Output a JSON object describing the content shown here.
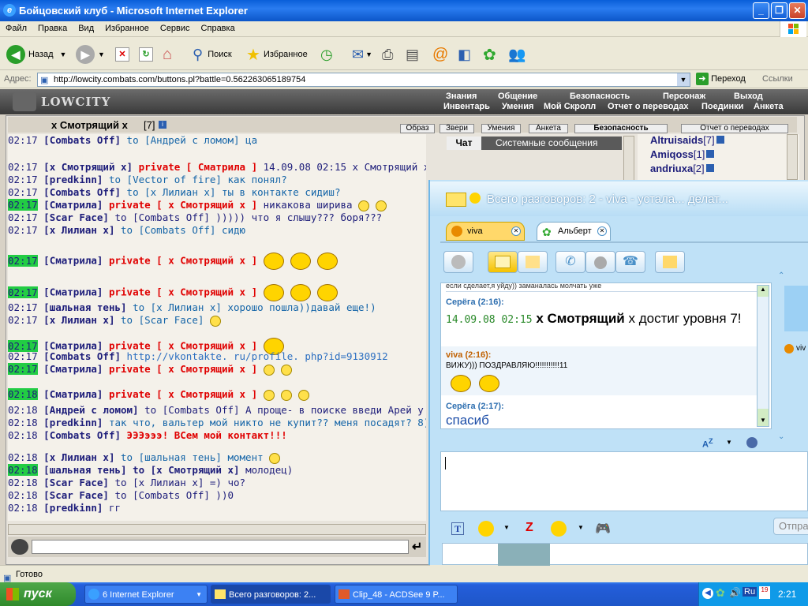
{
  "window": {
    "title": "Бойцовский клуб - Microsoft Internet Explorer"
  },
  "menu": [
    "Файл",
    "Правка",
    "Вид",
    "Избранное",
    "Сервис",
    "Справка"
  ],
  "toolbar": {
    "back": "Назад",
    "search": "Поиск",
    "favorites": "Избранное"
  },
  "address": {
    "label": "Адрес:",
    "url": "http://lowcity.combats.com/buttons.pl?battle=0.562263065189754",
    "go": "Переход",
    "links": "Ссылки"
  },
  "game": {
    "logo": "LOWCITY",
    "nav_top": [
      "Знания",
      "Общение",
      "Безопасность",
      "Персонаж",
      "Выход"
    ],
    "nav_bottom": [
      "Инвентарь",
      "Умения",
      "Мой Скролл",
      "Отчет о переводах",
      "Поединки",
      "Анкета"
    ],
    "current_user": "x Смотрящий x",
    "current_user_level": "[7]",
    "tabs_top": [
      "Образ",
      "Звери",
      "Умения",
      "Анкета",
      "Безопасность",
      "Отчет о переводах"
    ],
    "chat_tabs": [
      "Чат",
      "Системные сообщения"
    ],
    "userlist": [
      {
        "name": "Altruisaids",
        "level": "[7]"
      },
      {
        "name": "Amiqoss",
        "level": "[1]"
      },
      {
        "name": "andriuxa",
        "level": "[2]"
      }
    ],
    "chat": [
      {
        "time": "02:17",
        "hl": false,
        "nick": "[Combats Off]",
        "to": "to [Андрей с ломом] ца"
      },
      {
        "time": "02:17",
        "hl": false,
        "nick": "[x Смотрящий x]",
        "priv": "private [ Сматрила ]",
        "text": "14.09.08 02:15 x Смотрящий x достиг уровня 7!",
        "emo": 1
      },
      {
        "time": "02:17",
        "hl": false,
        "nick": "[predkinn]",
        "to": "to [Vector of fire] как понял?"
      },
      {
        "time": "02:17",
        "hl": false,
        "nick": "[Combats Off]",
        "to": "to [x Лилиан x] ты в контакте сидиш?"
      },
      {
        "time": "02:17",
        "hl": true,
        "nick": "[Сматрила]",
        "priv": "private [ x Смотрящий x ]",
        "text": "никакова ширива",
        "emo": 2
      },
      {
        "time": "02:17",
        "hl": false,
        "nick": "[Scar Face]",
        "text": "to [Combats Off] ))))) что я слышу??? боря???"
      },
      {
        "time": "02:17",
        "hl": false,
        "nick": "[x Лилиан x]",
        "to": "to [Combats Off] сидю"
      },
      {
        "time": "02:17",
        "hl": true,
        "nick": "[Сматрила]",
        "priv": "private [ x Смотрящий x ]",
        "emo": 3,
        "big": true
      },
      {
        "time": "02:17",
        "hl": true,
        "nick": "[Сматрила]",
        "priv": "private [ x Смотрящий x ]",
        "emo": 3,
        "big": true
      },
      {
        "time": "02:17",
        "hl": false,
        "nick": "[шальная тень]",
        "to": "to [x Лилиан x] хорошо пошла))давай еще!)"
      },
      {
        "time": "02:17",
        "hl": false,
        "nick": "[x Лилиан x]",
        "to": "to [Scar Face]",
        "emo": 1
      },
      {
        "time": "02:17",
        "hl": true,
        "nick": "[Сматрила]",
        "priv": "private [ x Смотрящий x ]",
        "emo": 1,
        "big": true
      },
      {
        "time": "02:17",
        "hl": false,
        "nick": "[Combats Off]",
        "link": "http://vkontakte. ru/profile. php?id=9130912"
      },
      {
        "time": "02:17",
        "hl": true,
        "nick": "[Сматрила]",
        "priv": "private [ x Смотрящий x ]",
        "emo": 2
      },
      {
        "time": "02:18",
        "hl": true,
        "nick": "[Сматрила]",
        "priv": "private [ x Смотрящий x ]",
        "emo": 3
      },
      {
        "time": "02:18",
        "hl": false,
        "nick": "[Андрей с ломом]",
        "text": "to [Combats Off] А проще- в поиске введи Арей у"
      },
      {
        "time": "02:18",
        "hl": false,
        "nick": "[predkinn]",
        "to": "так что, вальтер мой никто не купит?? меня посадят? 8)))"
      },
      {
        "time": "02:18",
        "hl": false,
        "nick": "[Combats Off]",
        "priv2": "ЭЭЭэээ! ВСем мой контакт!!!"
      },
      {
        "time": "02:18",
        "hl": false,
        "nick": "[x Лилиан x]",
        "to": "to [шальная тень] момент",
        "emo": 1
      },
      {
        "time": "02:18",
        "hl": true,
        "nick": "[шальная тень]",
        "to2": "to [x Смотрящий x]",
        "text": "молодец)"
      },
      {
        "time": "02:18",
        "hl": false,
        "nick": "[Scar Face]",
        "text": "to [x Лилиан x] =) чо?"
      },
      {
        "time": "02:18",
        "hl": false,
        "nick": "[Scar Face]",
        "text": "to [Combats Off] ))0"
      },
      {
        "time": "02:18",
        "hl": false,
        "nick": "[predkinn]",
        "text": "гг"
      }
    ]
  },
  "messenger": {
    "title": "Всего разговоров: 2 - viva - устала... делат...",
    "tabs": [
      "viva",
      "Альберт"
    ],
    "prev_line": "если сделает,я уйду)) заманалась молчать уже",
    "messages": [
      {
        "from": "Серёга (2:16):",
        "date": "14.09.08 02:15",
        "text_bold": "х Смотрящий",
        "text": "х достиг уровня 7!"
      },
      {
        "from": "viva (2:16):",
        "text": "ВИЖУ))) ПОЗДРАВЛЯЮ!!!!!!!!!!!11"
      },
      {
        "from": "Серёга (2:17):",
        "text": "спасиб"
      }
    ],
    "side_label": "viv",
    "send": "Отпра"
  },
  "status": {
    "text": "Готово"
  },
  "taskbar": {
    "start": "пуск",
    "tasks": [
      "6 Internet Explorer",
      "Всего разговоров: 2...",
      "Clip_48 - ACDSee 9 P..."
    ],
    "lang": "Ru",
    "clock": "2:21"
  }
}
